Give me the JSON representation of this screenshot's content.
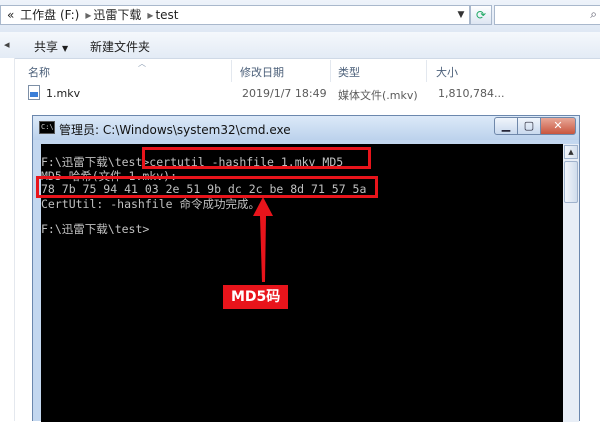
{
  "explorer": {
    "breadcrumb": [
      "工作盘 (F:)",
      "迅雷下载",
      "test"
    ],
    "toolbar": {
      "share_label": "共享",
      "new_folder_label": "新建文件夹"
    },
    "columns": [
      "名称",
      "修改日期",
      "类型",
      "大小"
    ],
    "files": [
      {
        "name": "1.mkv",
        "modified": "2019/1/7 18:49",
        "type": "媒体文件(.mkv)",
        "size": "1,810,784..."
      }
    ]
  },
  "cmd": {
    "title": "管理员: C:\\Windows\\system32\\cmd.exe",
    "icon_text": "C:\\",
    "lines": [
      "F:\\迅雷下载\\test>certutil -hashfile 1.mkv MD5",
      "MD5 哈希(文件 1.mkv):",
      "78 7b 75 94 41 03 2e 51 9b dc 2c be 8d 71 57 5a",
      "CertUtil: -hashfile 命令成功完成。",
      "F:\\迅雷下载\\test>"
    ]
  },
  "annotation": {
    "label": "MD5码",
    "color": "#e8141b"
  },
  "icons": {
    "share_caret": "chevron-down-icon",
    "back_arrow": "back-arrow-icon",
    "refresh": "refresh-icon",
    "search": "search-icon"
  }
}
